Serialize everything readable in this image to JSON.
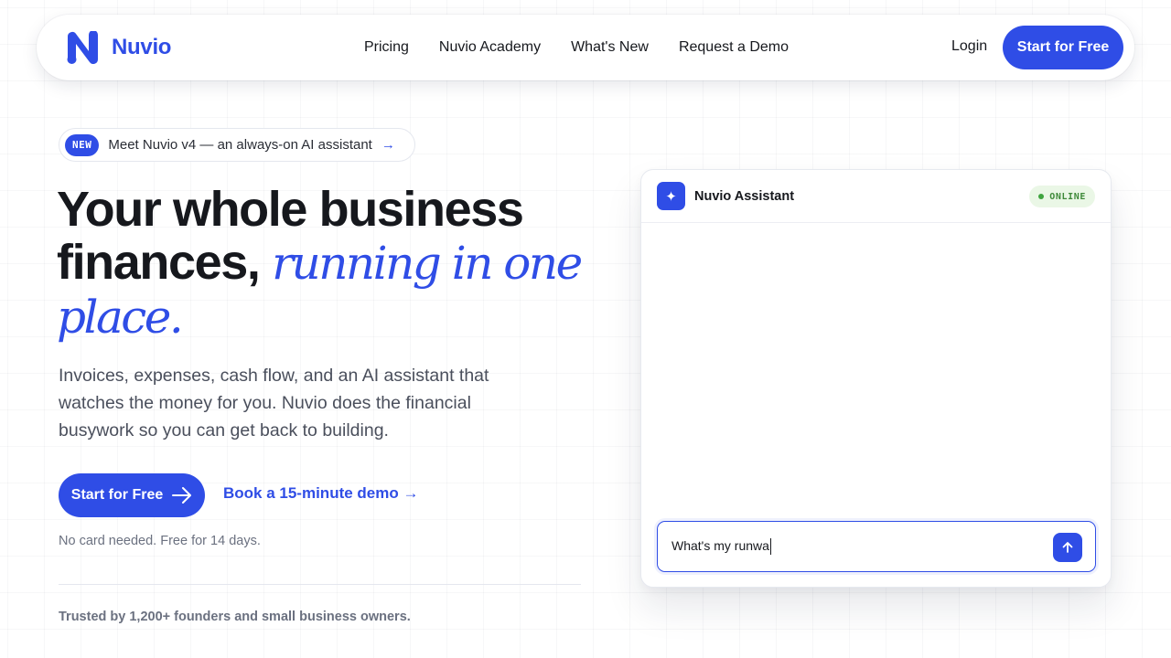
{
  "brand": {
    "name": "Nuvio",
    "accent_color": "#2f4de6",
    "logo_icon": "n-logo-icon"
  },
  "nav": {
    "links": [
      "Pricing",
      "Nuvio Academy",
      "What's New",
      "Request a Demo"
    ],
    "login": "Login",
    "cta": "Start for Free"
  },
  "announcement": {
    "badge": "NEW",
    "text": "Meet Nuvio v4 — an always-on AI assistant",
    "arrow": "→"
  },
  "hero": {
    "headline_plain": "Your whole business finances,",
    "headline_accent_a": "running in one",
    "headline_accent_b": "place.",
    "subtext": "Invoices, expenses, cash flow, and an AI assistant that watches the money for you. Nuvio does the financial busywork so you can get back to building.",
    "cta_primary": "Start for Free",
    "cta_secondary": "Book a 15-minute demo →",
    "fine_print": "No card needed. Free for 14 days.",
    "trusted": "Trusted by 1,200+ founders and small business owners."
  },
  "assistant": {
    "title": "Nuvio Assistant",
    "status": "ONLINE",
    "status_color": "#3fa43f",
    "input_value": "What's my runwa",
    "icon": "sparkle-icon",
    "send_icon": "arrow-up-icon"
  }
}
